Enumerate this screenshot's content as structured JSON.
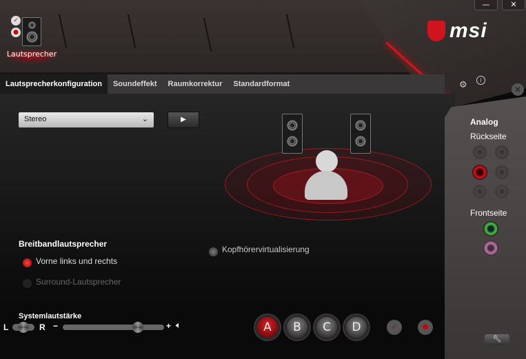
{
  "window": {
    "minimize": "—",
    "close": "✕"
  },
  "brand": {
    "logo_text": "msi"
  },
  "device": {
    "label": "Lautsprecher"
  },
  "tabs": [
    {
      "label": "Lautsprecherkonfiguration",
      "active": true
    },
    {
      "label": "Soundeffekt"
    },
    {
      "label": "Raumkorrektur"
    },
    {
      "label": "Standardformat"
    }
  ],
  "config": {
    "selected": "Stereo",
    "play": "▶"
  },
  "fullrange": {
    "title": "Breitbandlautsprecher",
    "option1": "Vorne links und rechts",
    "option2": "Surround-Lautsprecher"
  },
  "headphone": {
    "label": "Kopfhörervirtualisierung"
  },
  "volume": {
    "title": "Systemlautstärke",
    "left": "L",
    "right": "R",
    "minus": "−",
    "plus": "+",
    "level_percent": 74,
    "balance_percent": 50
  },
  "presets": [
    "A",
    "B",
    "C",
    "D"
  ],
  "right": {
    "analog": "Analog",
    "rear": "Rückseite",
    "front": "Frontseite"
  },
  "colors": {
    "accent": "#d0141e",
    "active_jack": "#e01020",
    "front_green": "#3fa83f",
    "front_pink": "#a76a9a"
  }
}
